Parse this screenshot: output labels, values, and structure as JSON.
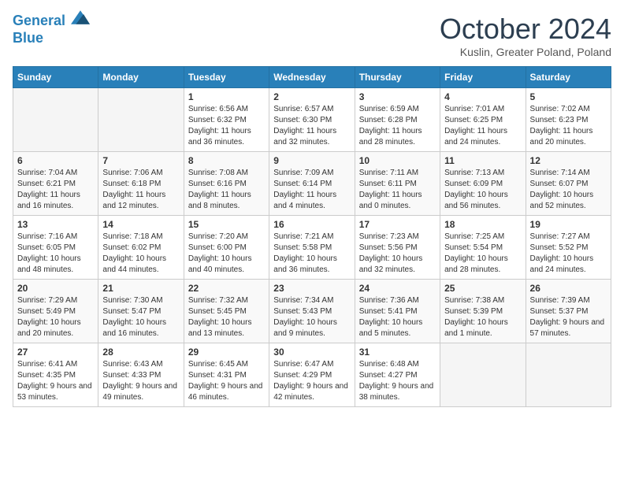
{
  "logo": {
    "line1": "General",
    "line2": "Blue"
  },
  "title": "October 2024",
  "subtitle": "Kuslin, Greater Poland, Poland",
  "days_header": [
    "Sunday",
    "Monday",
    "Tuesday",
    "Wednesday",
    "Thursday",
    "Friday",
    "Saturday"
  ],
  "weeks": [
    [
      {
        "day": "",
        "sunrise": "",
        "sunset": "",
        "daylight": ""
      },
      {
        "day": "",
        "sunrise": "",
        "sunset": "",
        "daylight": ""
      },
      {
        "day": "1",
        "sunrise": "Sunrise: 6:56 AM",
        "sunset": "Sunset: 6:32 PM",
        "daylight": "Daylight: 11 hours and 36 minutes."
      },
      {
        "day": "2",
        "sunrise": "Sunrise: 6:57 AM",
        "sunset": "Sunset: 6:30 PM",
        "daylight": "Daylight: 11 hours and 32 minutes."
      },
      {
        "day": "3",
        "sunrise": "Sunrise: 6:59 AM",
        "sunset": "Sunset: 6:28 PM",
        "daylight": "Daylight: 11 hours and 28 minutes."
      },
      {
        "day": "4",
        "sunrise": "Sunrise: 7:01 AM",
        "sunset": "Sunset: 6:25 PM",
        "daylight": "Daylight: 11 hours and 24 minutes."
      },
      {
        "day": "5",
        "sunrise": "Sunrise: 7:02 AM",
        "sunset": "Sunset: 6:23 PM",
        "daylight": "Daylight: 11 hours and 20 minutes."
      }
    ],
    [
      {
        "day": "6",
        "sunrise": "Sunrise: 7:04 AM",
        "sunset": "Sunset: 6:21 PM",
        "daylight": "Daylight: 11 hours and 16 minutes."
      },
      {
        "day": "7",
        "sunrise": "Sunrise: 7:06 AM",
        "sunset": "Sunset: 6:18 PM",
        "daylight": "Daylight: 11 hours and 12 minutes."
      },
      {
        "day": "8",
        "sunrise": "Sunrise: 7:08 AM",
        "sunset": "Sunset: 6:16 PM",
        "daylight": "Daylight: 11 hours and 8 minutes."
      },
      {
        "day": "9",
        "sunrise": "Sunrise: 7:09 AM",
        "sunset": "Sunset: 6:14 PM",
        "daylight": "Daylight: 11 hours and 4 minutes."
      },
      {
        "day": "10",
        "sunrise": "Sunrise: 7:11 AM",
        "sunset": "Sunset: 6:11 PM",
        "daylight": "Daylight: 11 hours and 0 minutes."
      },
      {
        "day": "11",
        "sunrise": "Sunrise: 7:13 AM",
        "sunset": "Sunset: 6:09 PM",
        "daylight": "Daylight: 10 hours and 56 minutes."
      },
      {
        "day": "12",
        "sunrise": "Sunrise: 7:14 AM",
        "sunset": "Sunset: 6:07 PM",
        "daylight": "Daylight: 10 hours and 52 minutes."
      }
    ],
    [
      {
        "day": "13",
        "sunrise": "Sunrise: 7:16 AM",
        "sunset": "Sunset: 6:05 PM",
        "daylight": "Daylight: 10 hours and 48 minutes."
      },
      {
        "day": "14",
        "sunrise": "Sunrise: 7:18 AM",
        "sunset": "Sunset: 6:02 PM",
        "daylight": "Daylight: 10 hours and 44 minutes."
      },
      {
        "day": "15",
        "sunrise": "Sunrise: 7:20 AM",
        "sunset": "Sunset: 6:00 PM",
        "daylight": "Daylight: 10 hours and 40 minutes."
      },
      {
        "day": "16",
        "sunrise": "Sunrise: 7:21 AM",
        "sunset": "Sunset: 5:58 PM",
        "daylight": "Daylight: 10 hours and 36 minutes."
      },
      {
        "day": "17",
        "sunrise": "Sunrise: 7:23 AM",
        "sunset": "Sunset: 5:56 PM",
        "daylight": "Daylight: 10 hours and 32 minutes."
      },
      {
        "day": "18",
        "sunrise": "Sunrise: 7:25 AM",
        "sunset": "Sunset: 5:54 PM",
        "daylight": "Daylight: 10 hours and 28 minutes."
      },
      {
        "day": "19",
        "sunrise": "Sunrise: 7:27 AM",
        "sunset": "Sunset: 5:52 PM",
        "daylight": "Daylight: 10 hours and 24 minutes."
      }
    ],
    [
      {
        "day": "20",
        "sunrise": "Sunrise: 7:29 AM",
        "sunset": "Sunset: 5:49 PM",
        "daylight": "Daylight: 10 hours and 20 minutes."
      },
      {
        "day": "21",
        "sunrise": "Sunrise: 7:30 AM",
        "sunset": "Sunset: 5:47 PM",
        "daylight": "Daylight: 10 hours and 16 minutes."
      },
      {
        "day": "22",
        "sunrise": "Sunrise: 7:32 AM",
        "sunset": "Sunset: 5:45 PM",
        "daylight": "Daylight: 10 hours and 13 minutes."
      },
      {
        "day": "23",
        "sunrise": "Sunrise: 7:34 AM",
        "sunset": "Sunset: 5:43 PM",
        "daylight": "Daylight: 10 hours and 9 minutes."
      },
      {
        "day": "24",
        "sunrise": "Sunrise: 7:36 AM",
        "sunset": "Sunset: 5:41 PM",
        "daylight": "Daylight: 10 hours and 5 minutes."
      },
      {
        "day": "25",
        "sunrise": "Sunrise: 7:38 AM",
        "sunset": "Sunset: 5:39 PM",
        "daylight": "Daylight: 10 hours and 1 minute."
      },
      {
        "day": "26",
        "sunrise": "Sunrise: 7:39 AM",
        "sunset": "Sunset: 5:37 PM",
        "daylight": "Daylight: 9 hours and 57 minutes."
      }
    ],
    [
      {
        "day": "27",
        "sunrise": "Sunrise: 6:41 AM",
        "sunset": "Sunset: 4:35 PM",
        "daylight": "Daylight: 9 hours and 53 minutes."
      },
      {
        "day": "28",
        "sunrise": "Sunrise: 6:43 AM",
        "sunset": "Sunset: 4:33 PM",
        "daylight": "Daylight: 9 hours and 49 minutes."
      },
      {
        "day": "29",
        "sunrise": "Sunrise: 6:45 AM",
        "sunset": "Sunset: 4:31 PM",
        "daylight": "Daylight: 9 hours and 46 minutes."
      },
      {
        "day": "30",
        "sunrise": "Sunrise: 6:47 AM",
        "sunset": "Sunset: 4:29 PM",
        "daylight": "Daylight: 9 hours and 42 minutes."
      },
      {
        "day": "31",
        "sunrise": "Sunrise: 6:48 AM",
        "sunset": "Sunset: 4:27 PM",
        "daylight": "Daylight: 9 hours and 38 minutes."
      },
      {
        "day": "",
        "sunrise": "",
        "sunset": "",
        "daylight": ""
      },
      {
        "day": "",
        "sunrise": "",
        "sunset": "",
        "daylight": ""
      }
    ]
  ]
}
